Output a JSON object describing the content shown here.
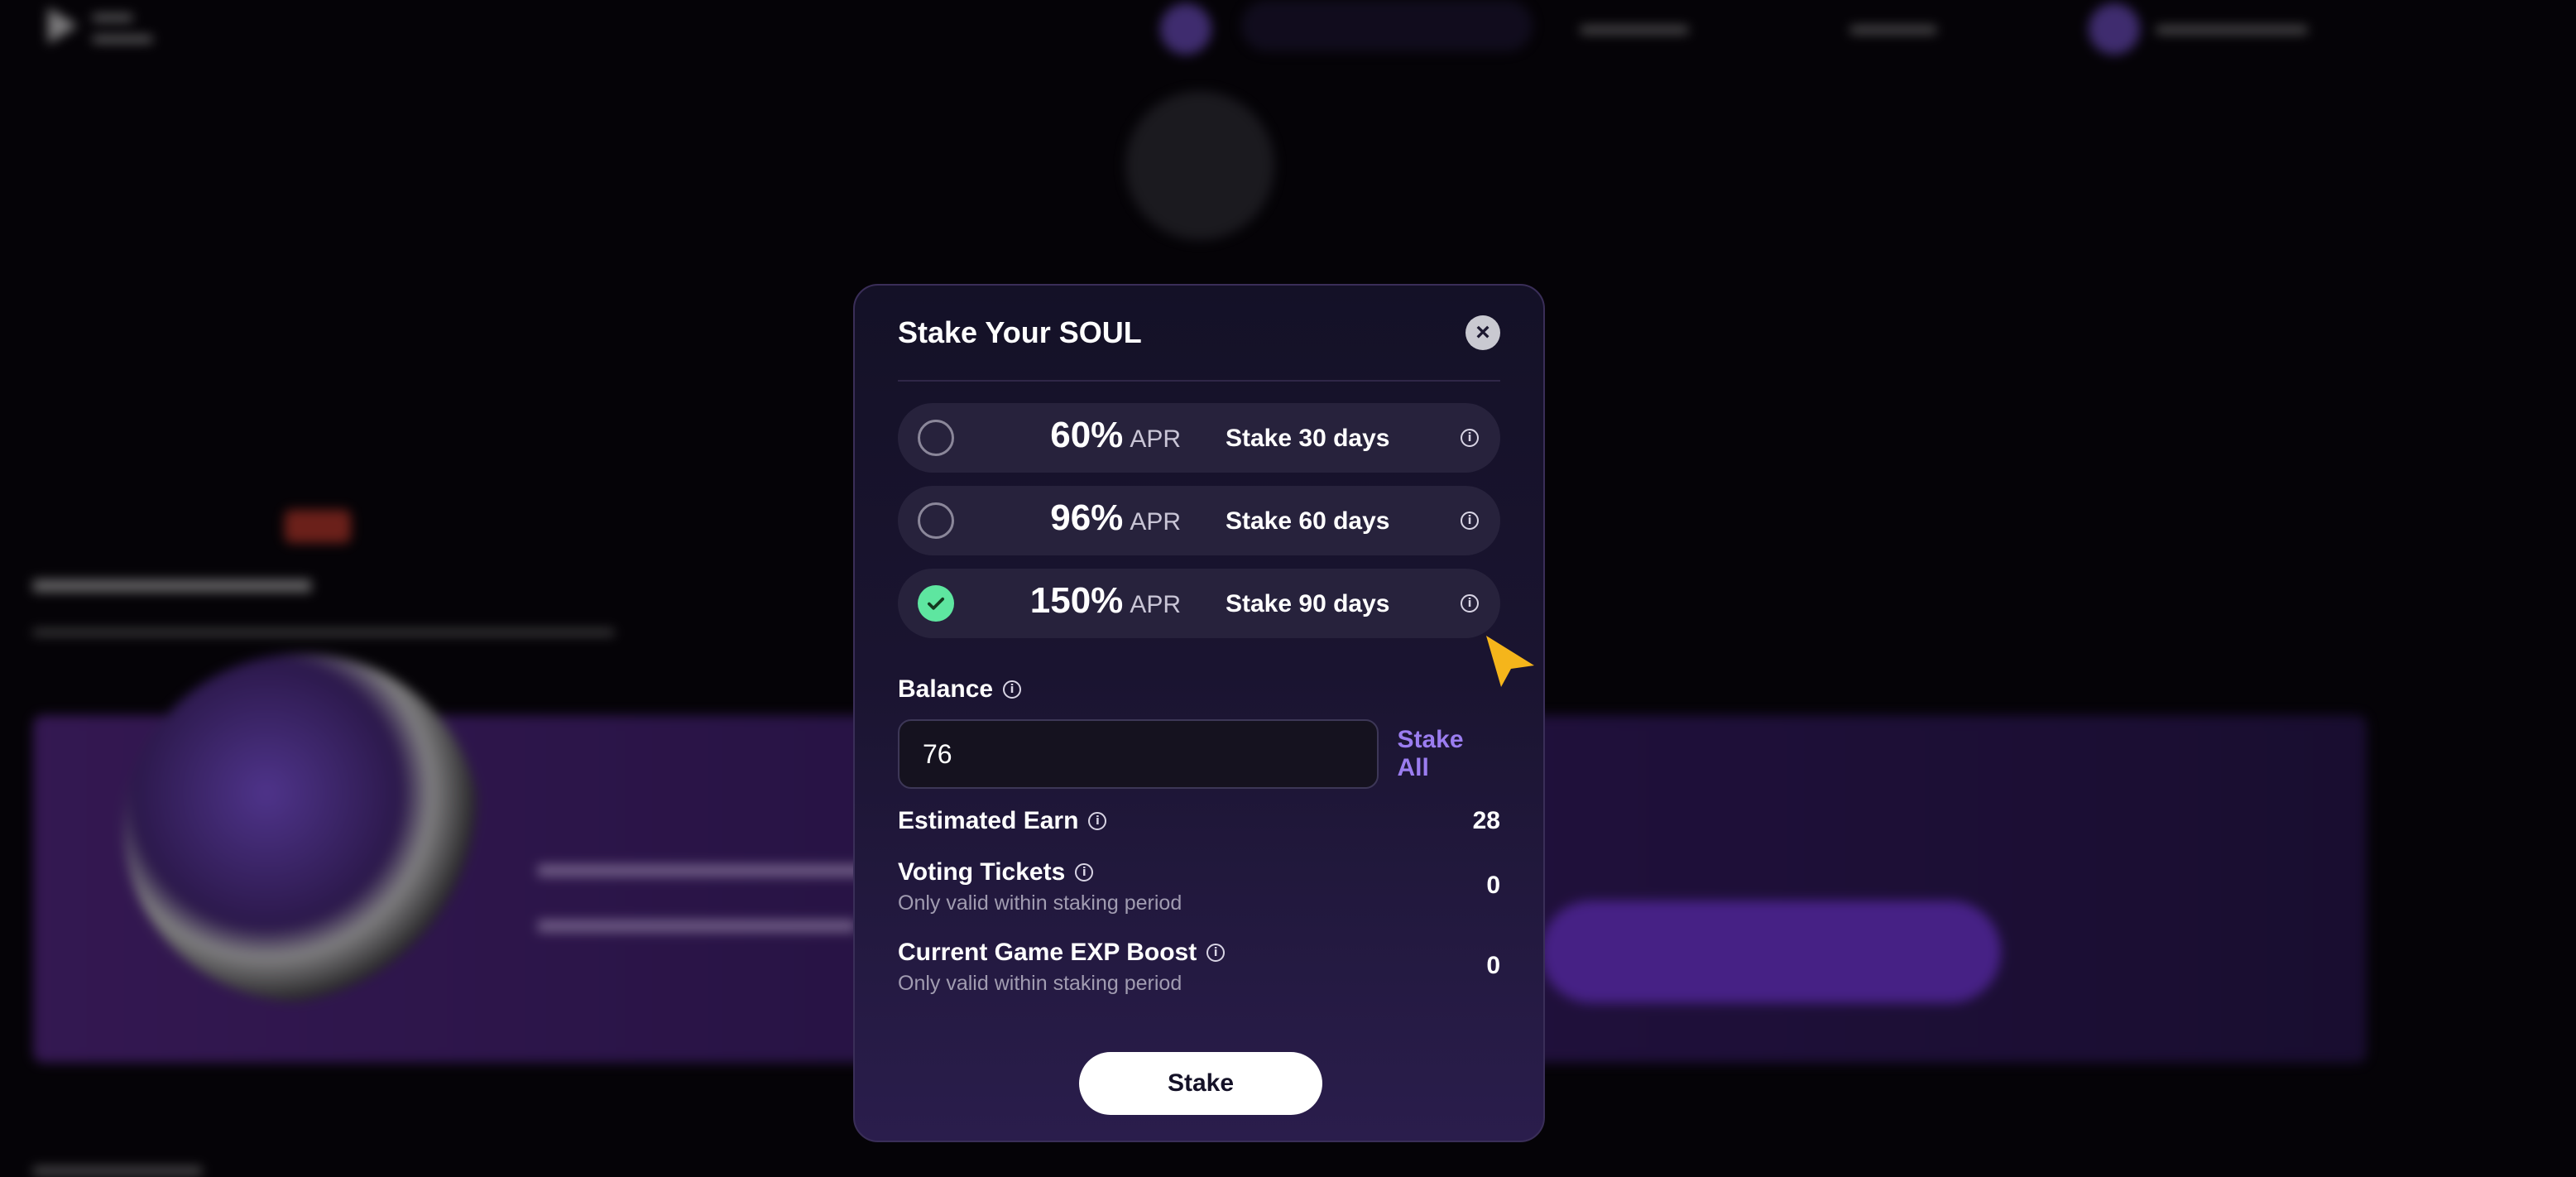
{
  "modal": {
    "title": "Stake Your SOUL",
    "close_icon": "close-icon",
    "options": [
      {
        "apr": "60%",
        "apr_label": "APR",
        "duration": "Stake 30 days",
        "selected": false
      },
      {
        "apr": "96%",
        "apr_label": "APR",
        "duration": "Stake 60 days",
        "selected": false
      },
      {
        "apr": "150%",
        "apr_label": "APR",
        "duration": "Stake 90 days",
        "selected": true
      }
    ],
    "balance": {
      "label": "Balance",
      "input_value": "76",
      "stake_all_label": "Stake All"
    },
    "rows": [
      {
        "label": "Estimated Earn",
        "note": "",
        "value": "28"
      },
      {
        "label": "Voting Tickets",
        "note": "Only valid within staking period",
        "value": "0"
      },
      {
        "label": "Current Game EXP Boost",
        "note": "Only valid within staking period",
        "value": "0"
      }
    ],
    "stake_button_label": "Stake"
  },
  "colors": {
    "modal_bg": "#1a1430",
    "selected_check": "#5ee6a0",
    "accent": "#9b7df0",
    "cursor": "#f5b51b"
  }
}
